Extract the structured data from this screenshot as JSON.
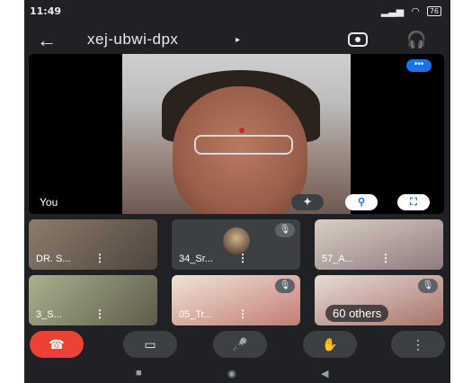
{
  "status_bar": {
    "time": "11:49",
    "battery": "76"
  },
  "header": {
    "meeting_code": "xej-ubwi-dpx",
    "caret": "▸"
  },
  "main_video": {
    "self_label": "You",
    "more_label": "•••",
    "pin_label": "⚲",
    "fullscreen_label": "⛶",
    "effects_label": "✦"
  },
  "tiles": [
    {
      "label": "DR. S...",
      "menu": "⋮"
    },
    {
      "label": "34_Sr...",
      "menu": "⋮"
    },
    {
      "label": "57_A...",
      "menu": "⋮"
    },
    {
      "label": "3_S...",
      "menu": "⋮"
    },
    {
      "label": "05_Tr...",
      "menu": "⋮"
    },
    {
      "label": "60 others",
      "menu": ""
    }
  ],
  "controls": {
    "end_call_label": "☎",
    "camera_label": "▭",
    "mic_label": "🎤",
    "raise_hand_label": "✋",
    "more_label": "⋮"
  },
  "icons": {
    "back": "back-arrow-icon",
    "switch_camera": "switch-camera-icon",
    "audio_output": "headphones-icon",
    "mic_off": "mic-off-icon"
  },
  "colors": {
    "accent": "#1a73e8",
    "end_call": "#ea4335",
    "background": "#202124"
  }
}
